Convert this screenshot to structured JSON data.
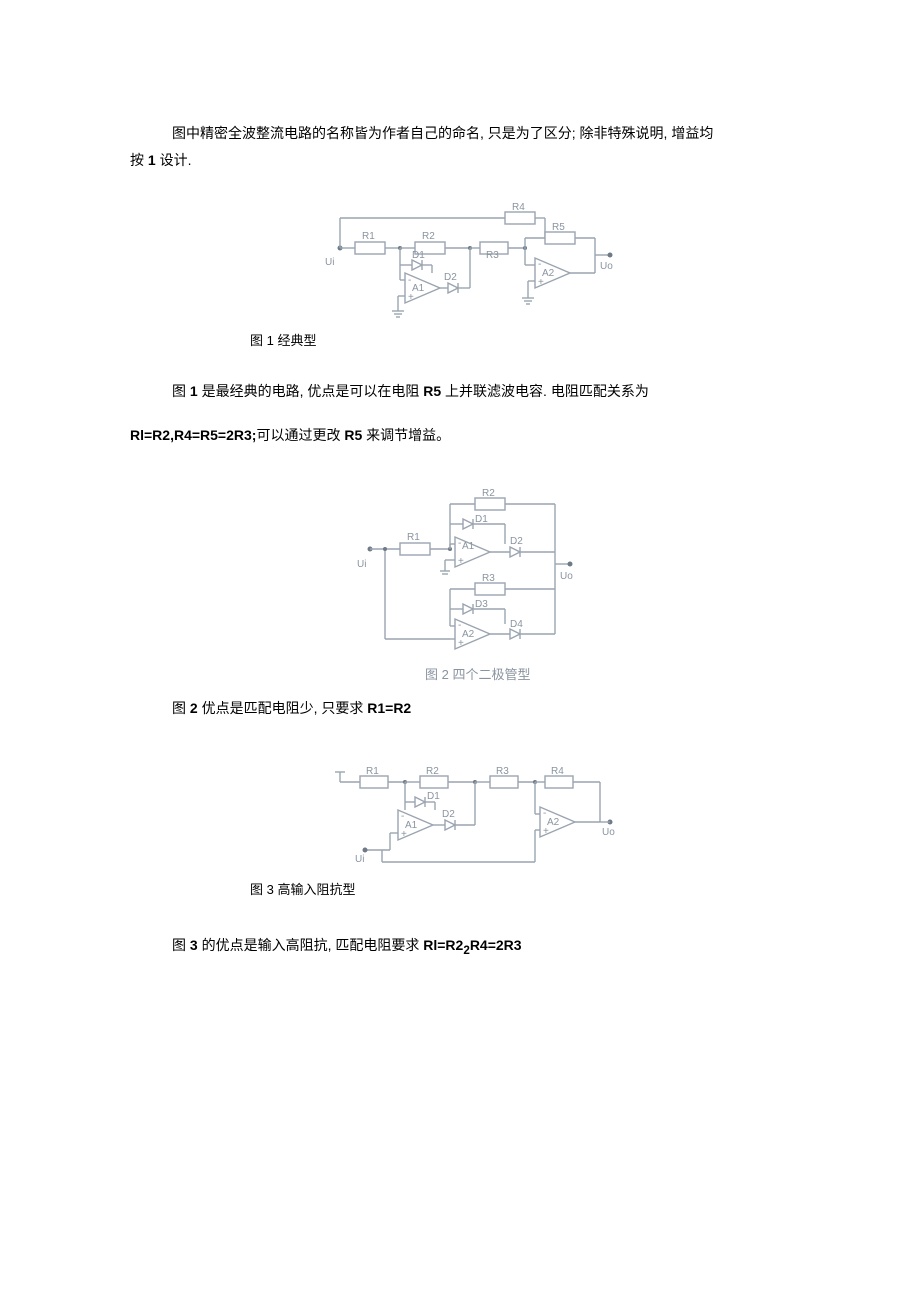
{
  "intro": {
    "line1": "图中精密全波整流电路的名称皆为作者自己的命名, 只是为了区分; 除非特殊说明, 增益均",
    "line2_pre": "按 ",
    "line2_bold": "1",
    "line2_post": " 设计."
  },
  "fig1": {
    "caption": "图 1 经典型",
    "labels": {
      "Ui": "Ui",
      "Uo": "Uo",
      "R1": "R1",
      "R2": "R2",
      "R3": "R3",
      "R4": "R4",
      "R5": "R5",
      "D1": "D1",
      "D2": "D2",
      "A1": "A1",
      "A2": "A2"
    }
  },
  "para1": {
    "pre": "图 ",
    "b1": "1",
    "mid1": " 是最经典的电路, 优点是可以在电阻 ",
    "b2": "R5",
    "post": " 上并联滤波电容. 电阻匹配关系为"
  },
  "formula1": {
    "b1": "Rl=R2,R4=R5=2R3;",
    "mid": "可以通过更改 ",
    "b2": "R5",
    "post": " 来调节增益。"
  },
  "fig2": {
    "caption_in_svg": "图 2 四个二极管型",
    "labels": {
      "Ui": "Ui",
      "Uo": "Uo",
      "R1": "R1",
      "R2": "R2",
      "R3": "R3",
      "A1": "A1",
      "A2": "A2",
      "D1": "D1",
      "D2": "D2",
      "D3": "D3",
      "D4": "D4"
    }
  },
  "para2": {
    "pre": "图 ",
    "b1": "2",
    "mid": " 优点是匹配电阻少, 只要求 ",
    "b2": "R1=R2"
  },
  "fig3": {
    "caption": "图 3 高输入阻抗型",
    "labels": {
      "Ui": "Ui",
      "Uo": "Uo",
      "R1": "R1",
      "R2": "R2",
      "R3": "R3",
      "R4": "R4",
      "A1": "A1",
      "A2": "A2",
      "D1": "D1",
      "D2": "D2"
    }
  },
  "para3": {
    "pre": "图 ",
    "b1": "3",
    "mid": " 的优点是输入高阻抗, 匹配电阻要求 ",
    "b2_a": "Rl=R2",
    "b2_b": "R4=2R3",
    "sub": "2"
  }
}
